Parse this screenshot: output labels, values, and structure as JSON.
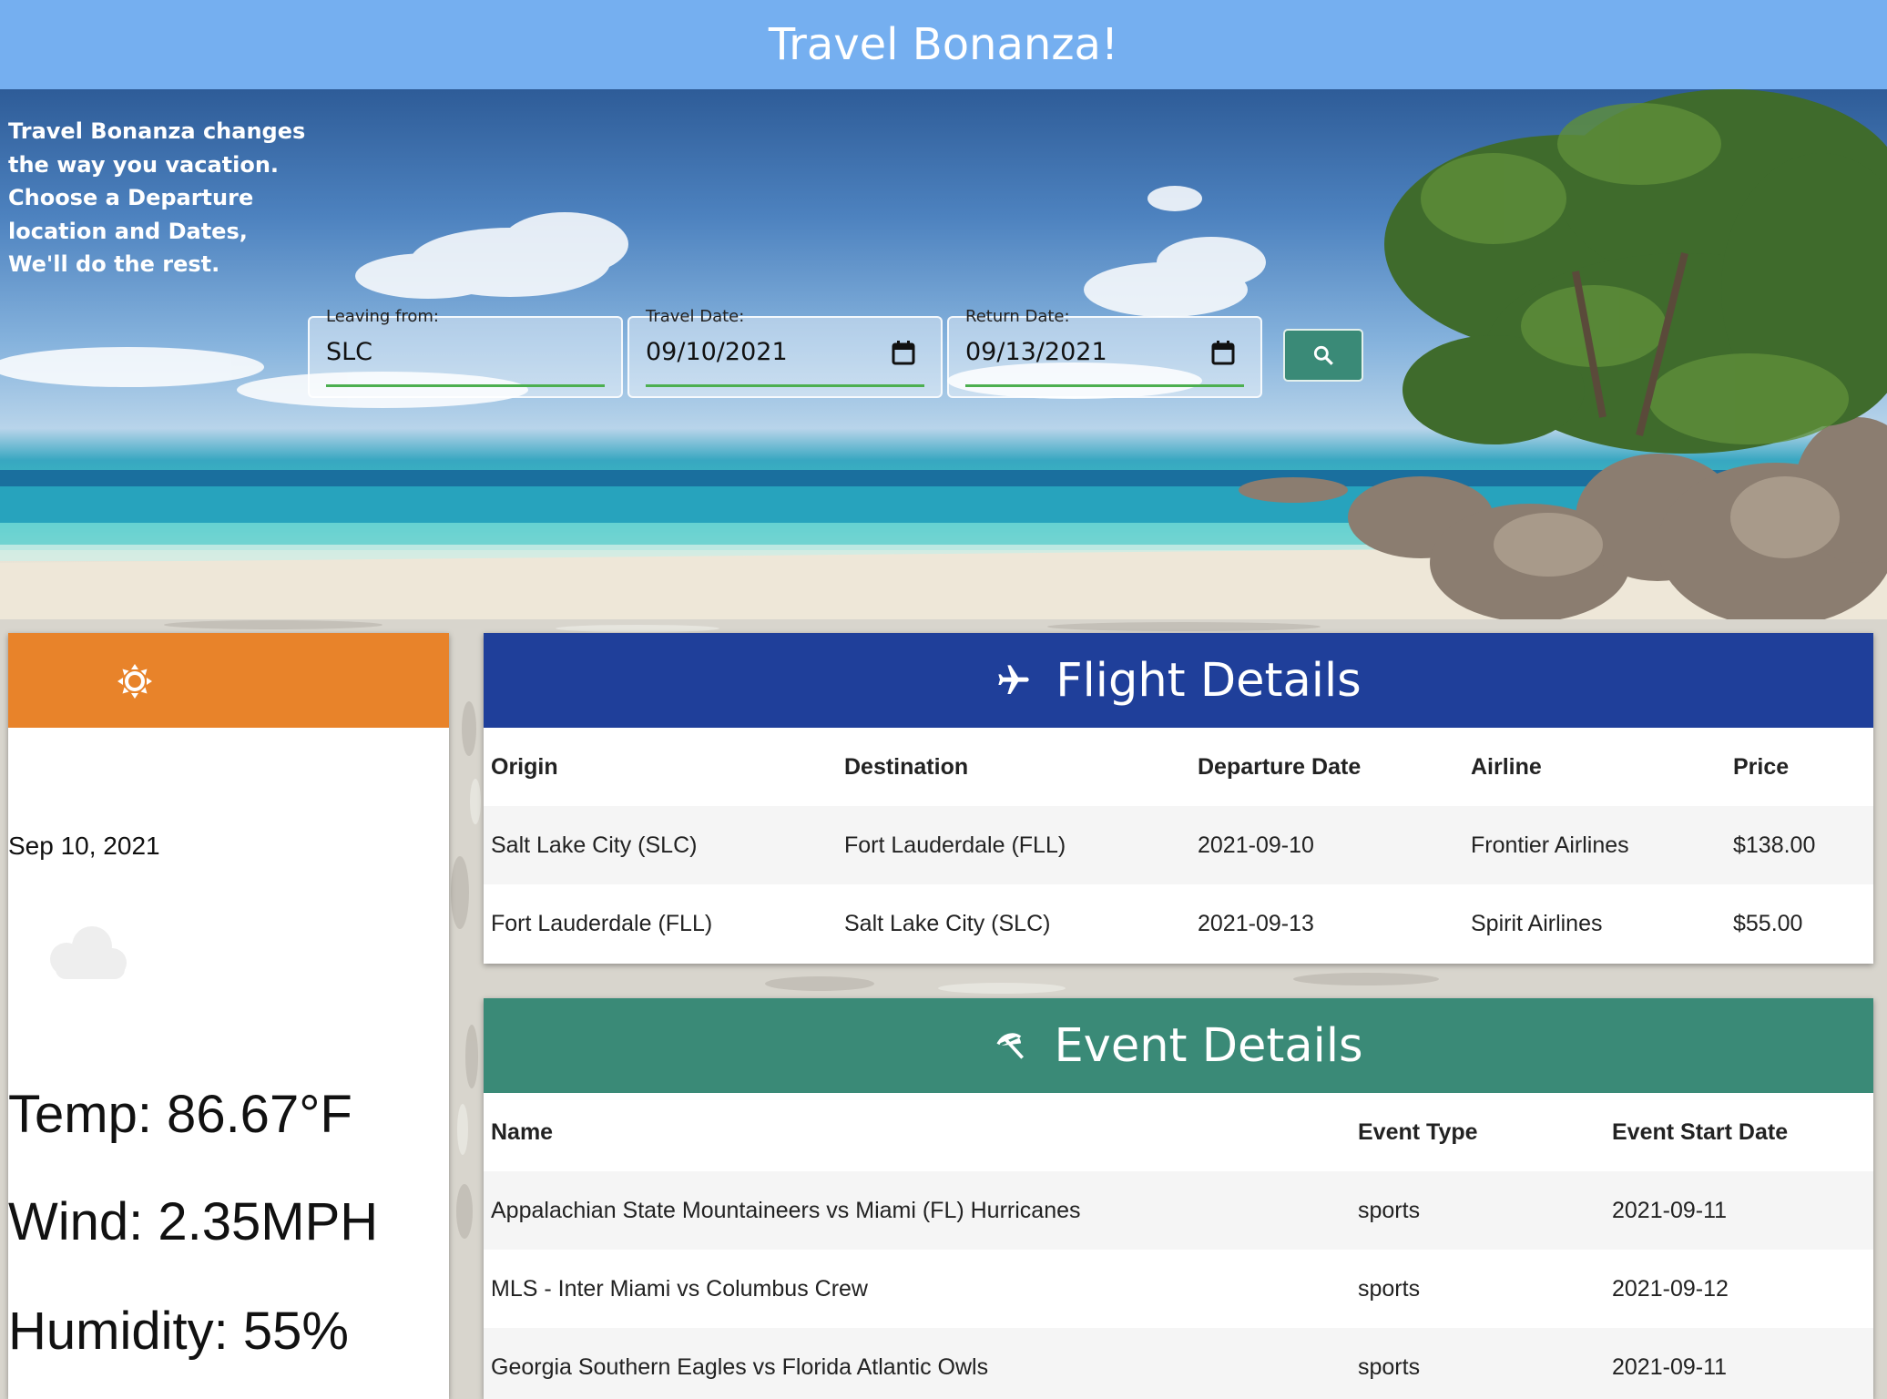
{
  "app": {
    "title": "Travel Bonanza!"
  },
  "hero": {
    "tagline": "Travel Bonanza changes the way you vacation. Choose a Departure location and Dates, We'll do the rest.",
    "leaving_from": {
      "label": "Leaving from:",
      "value": "SLC"
    },
    "travel_date": {
      "label": "Travel Date:",
      "value": "09/10/2021"
    },
    "return_date": {
      "label": "Return Date:",
      "value": "09/13/2021"
    },
    "search_icon": "search-icon"
  },
  "weather": {
    "header_icon": "sun-icon",
    "date": "Sep 10, 2021",
    "condition_icon": "cloud-icon",
    "temp": "Temp: 86.67°F",
    "wind": "Wind: 2.35MPH",
    "humidity": "Humidity: 55%"
  },
  "flights": {
    "title": "Flight Details",
    "icon": "airplane-icon",
    "columns": [
      "Origin",
      "Destination",
      "Departure Date",
      "Airline",
      "Price"
    ],
    "rows": [
      [
        "Salt Lake City (SLC)",
        "Fort Lauderdale (FLL)",
        "2021-09-10",
        "Frontier Airlines",
        "$138.00"
      ],
      [
        "Fort Lauderdale (FLL)",
        "Salt Lake City (SLC)",
        "2021-09-13",
        "Spirit Airlines",
        "$55.00"
      ]
    ]
  },
  "events": {
    "title": "Event Details",
    "icon": "beach-umbrella-icon",
    "columns": [
      "Name",
      "Event Type",
      "Event Start Date"
    ],
    "rows": [
      [
        "Appalachian State Mountaineers vs Miami (FL) Hurricanes",
        "sports",
        "2021-09-11"
      ],
      [
        "MLS - Inter Miami vs Columbus Crew",
        "sports",
        "2021-09-12"
      ],
      [
        "Georgia Southern Eagles vs Florida Atlantic Owls",
        "sports",
        "2021-09-11"
      ]
    ]
  },
  "colors": {
    "topbar": "#75aff0",
    "weather_header": "#e8832a",
    "flight_header": "#1f3f9a",
    "event_header": "#3a8a77",
    "search_button": "#3a8a77",
    "field_underline": "#4caf50"
  }
}
